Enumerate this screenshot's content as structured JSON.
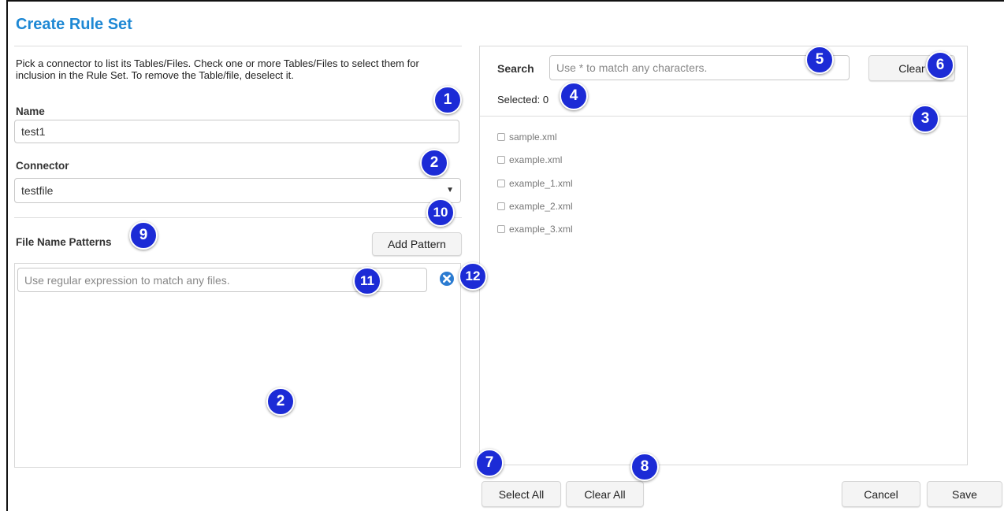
{
  "page": {
    "title": "Create Rule Set",
    "instructions": "Pick a connector to list its Tables/Files. Check one or more Tables/Files to select them for inclusion in the Rule Set. To remove the Table/file, deselect it."
  },
  "form": {
    "name_label": "Name",
    "name_value": "test1",
    "connector_label": "Connector",
    "connector_value": "testfile",
    "patterns_label": "File Name Patterns",
    "add_pattern_label": "Add Pattern",
    "pattern_placeholder": "Use regular expression to match any files."
  },
  "file_browser": {
    "search_label": "Search",
    "search_placeholder": "Use * to match any characters.",
    "clear_label": "Clear",
    "selected_text": "Selected: 0",
    "files": [
      "sample.xml",
      "example.xml",
      "example_1.xml",
      "example_2.xml",
      "example_3.xml"
    ],
    "select_all_label": "Select All",
    "clear_all_label": "Clear All"
  },
  "footer": {
    "cancel_label": "Cancel",
    "save_label": "Save"
  },
  "callouts": {
    "c1": "1",
    "c2": "2",
    "c3": "3",
    "c4": "4",
    "c5": "5",
    "c6": "6",
    "c7": "7",
    "c8": "8",
    "c9": "9",
    "c10": "10",
    "c11": "11",
    "c12": "12",
    "c2b": "2"
  },
  "colors": {
    "title": "#1e88d4",
    "callout": "#1c2bd6",
    "remove_icon": "#2b7bd1"
  },
  "icons": {
    "remove": "close-circle-icon",
    "dropdown": "caret-down-icon"
  }
}
